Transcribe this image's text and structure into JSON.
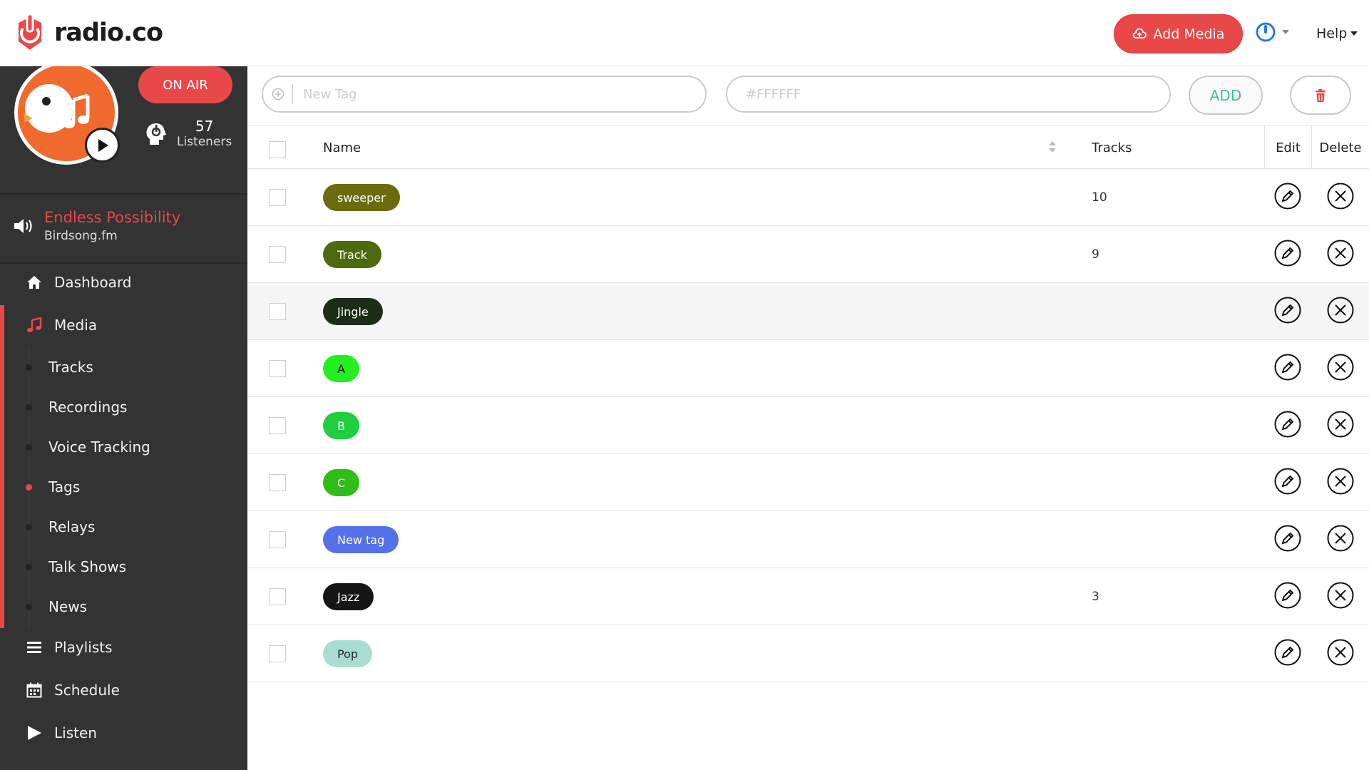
{
  "header": {
    "logo_text": "radio.co",
    "add_media_label": "Add Media",
    "help_label": "Help",
    "colors": {
      "brand": "#e94848",
      "power": "#2b7bd8"
    }
  },
  "station": {
    "on_air_label": "ON AIR",
    "listeners_count": "57",
    "listeners_label": "Listeners",
    "now_playing_title": "Endless Possibility",
    "now_playing_artist": "Birdsong.fm"
  },
  "nav": {
    "dashboard": "Dashboard",
    "media": "Media",
    "sub": [
      "Tracks",
      "Recordings",
      "Voice Tracking",
      "Tags",
      "Relays",
      "Talk Shows",
      "News"
    ],
    "active_sub": "Tags",
    "playlists": "Playlists",
    "schedule": "Schedule",
    "listen": "Listen"
  },
  "form": {
    "tag_placeholder": "New Tag",
    "color_placeholder": "#FFFFFF",
    "add_label": "ADD"
  },
  "table": {
    "headers": {
      "name": "Name",
      "tracks": "Tracks",
      "edit": "Edit",
      "delete": "Delete"
    },
    "rows": [
      {
        "name": "sweeper",
        "tracks": "10",
        "color": "#6b6b0e",
        "text_color": "#ffffff"
      },
      {
        "name": "Track",
        "tracks": "9",
        "color": "#4d6a0d",
        "text_color": "#ffffff"
      },
      {
        "name": "Jingle",
        "tracks": "",
        "color": "#1b2d14",
        "text_color": "#ffffff"
      },
      {
        "name": "A",
        "tracks": "",
        "color": "#22ee22",
        "text_color": "#111111"
      },
      {
        "name": "B",
        "tracks": "",
        "color": "#1fcf3d",
        "text_color": "#ffffff"
      },
      {
        "name": "C",
        "tracks": "",
        "color": "#2fbd17",
        "text_color": "#ffffff"
      },
      {
        "name": "New tag",
        "tracks": "",
        "color": "#5571ea",
        "text_color": "#ffffff"
      },
      {
        "name": "Jazz",
        "tracks": "3",
        "color": "#161616",
        "text_color": "#ffffff"
      },
      {
        "name": "Pop",
        "tracks": "",
        "color": "#a9dcd3",
        "text_color": "#222222"
      }
    ]
  }
}
